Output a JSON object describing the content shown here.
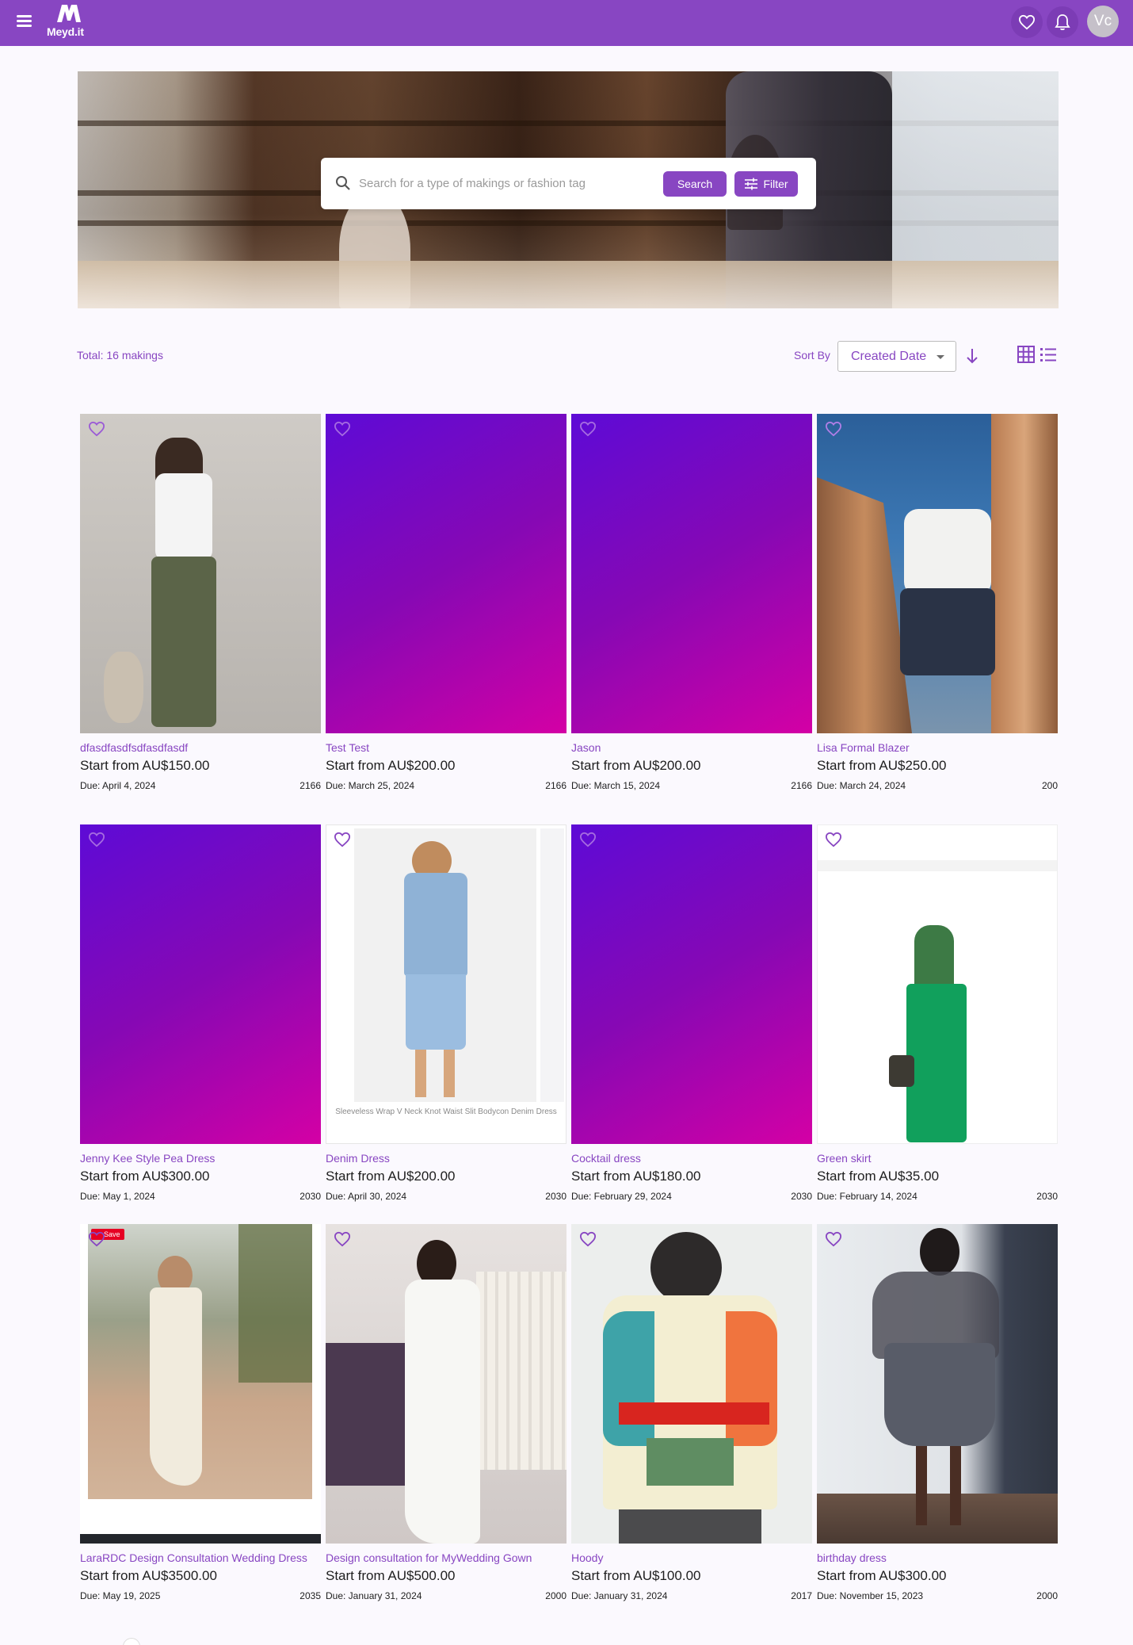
{
  "header": {
    "logo_text": "Meyd.it",
    "avatar_initials": "Vc",
    "icons": [
      "menu-icon",
      "heart-icon",
      "bell-icon"
    ]
  },
  "hero": {
    "search_placeholder": "Search for a type of makings or fashion tag",
    "search_value": "",
    "search_button": "Search",
    "filter_button": "Filter"
  },
  "toolbar": {
    "total": "Total: 16 makings",
    "sort_label": "Sort By",
    "sort_value": "Created Date",
    "sort_direction": "descending"
  },
  "colors": {
    "brand": "#8846c2",
    "gradient_start": "#5d0bd6",
    "gradient_end": "#d400a5"
  },
  "products": [
    {
      "name": "dfasdfasdfsdfasdfasdf",
      "price": "Start from AU$150.00",
      "due": "Due: April 4, 2024",
      "count": "2166"
    },
    {
      "name": "Test Test",
      "price": "Start from AU$200.00",
      "due": "Due: March 25, 2024",
      "count": "2166"
    },
    {
      "name": "Jason",
      "price": "Start from AU$200.00",
      "due": "Due: March 15, 2024",
      "count": "2166"
    },
    {
      "name": "Lisa Formal Blazer",
      "price": "Start from AU$250.00",
      "due": "Due: March 24, 2024",
      "count": "200"
    },
    {
      "name": "Jenny Kee Style Pea Dress",
      "price": "Start from AU$300.00",
      "due": "Due: May 1, 2024",
      "count": "2030"
    },
    {
      "name": "Denim Dress",
      "price": "Start from AU$200.00",
      "due": "Due: April 30, 2024",
      "count": "2030",
      "image_caption": "Sleeveless Wrap V Neck Knot Waist Slit Bodycon Denim Dress"
    },
    {
      "name": "Cocktail dress",
      "price": "Start from AU$180.00",
      "due": "Due: February 29, 2024",
      "count": "2030"
    },
    {
      "name": "Green skirt",
      "price": "Start from AU$35.00",
      "due": "Due: February 14, 2024",
      "count": "2030"
    },
    {
      "name": "LaraRDC Design Consultation Wedding Dress",
      "price": "Start from AU$3500.00",
      "due": "Due: May 19, 2025",
      "count": "2035",
      "image_badge": "Save"
    },
    {
      "name": "Design consultation for MyWedding Gown",
      "price": "Start from AU$500.00",
      "due": "Due: January 31, 2024",
      "count": "2000"
    },
    {
      "name": "Hoody",
      "price": "Start from AU$100.00",
      "due": "Due: January 31, 2024",
      "count": "2017"
    },
    {
      "name": "birthday dress",
      "price": "Start from AU$300.00",
      "due": "Due: November 15, 2023",
      "count": "2000"
    }
  ]
}
